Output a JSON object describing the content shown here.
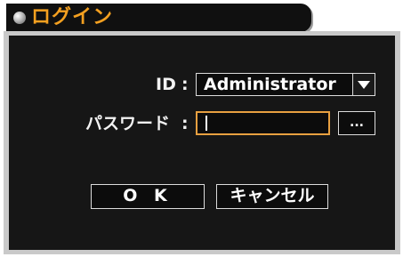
{
  "window": {
    "title": "ログイン"
  },
  "form": {
    "id_label": "ID",
    "password_label": "パスワード",
    "separator": ":",
    "id_value": "Administrator",
    "password_value": "",
    "ellipsis_label": "..."
  },
  "buttons": {
    "ok_label": "O K",
    "cancel_label": "キャンセル"
  },
  "colors": {
    "title_accent": "#f4a020",
    "field_focus_border": "#e8a040",
    "panel_background": "#161616",
    "frame": "#c9c9c9"
  },
  "icons": {
    "title": "status-orb-icon",
    "dropdown": "triangle-down-icon"
  }
}
